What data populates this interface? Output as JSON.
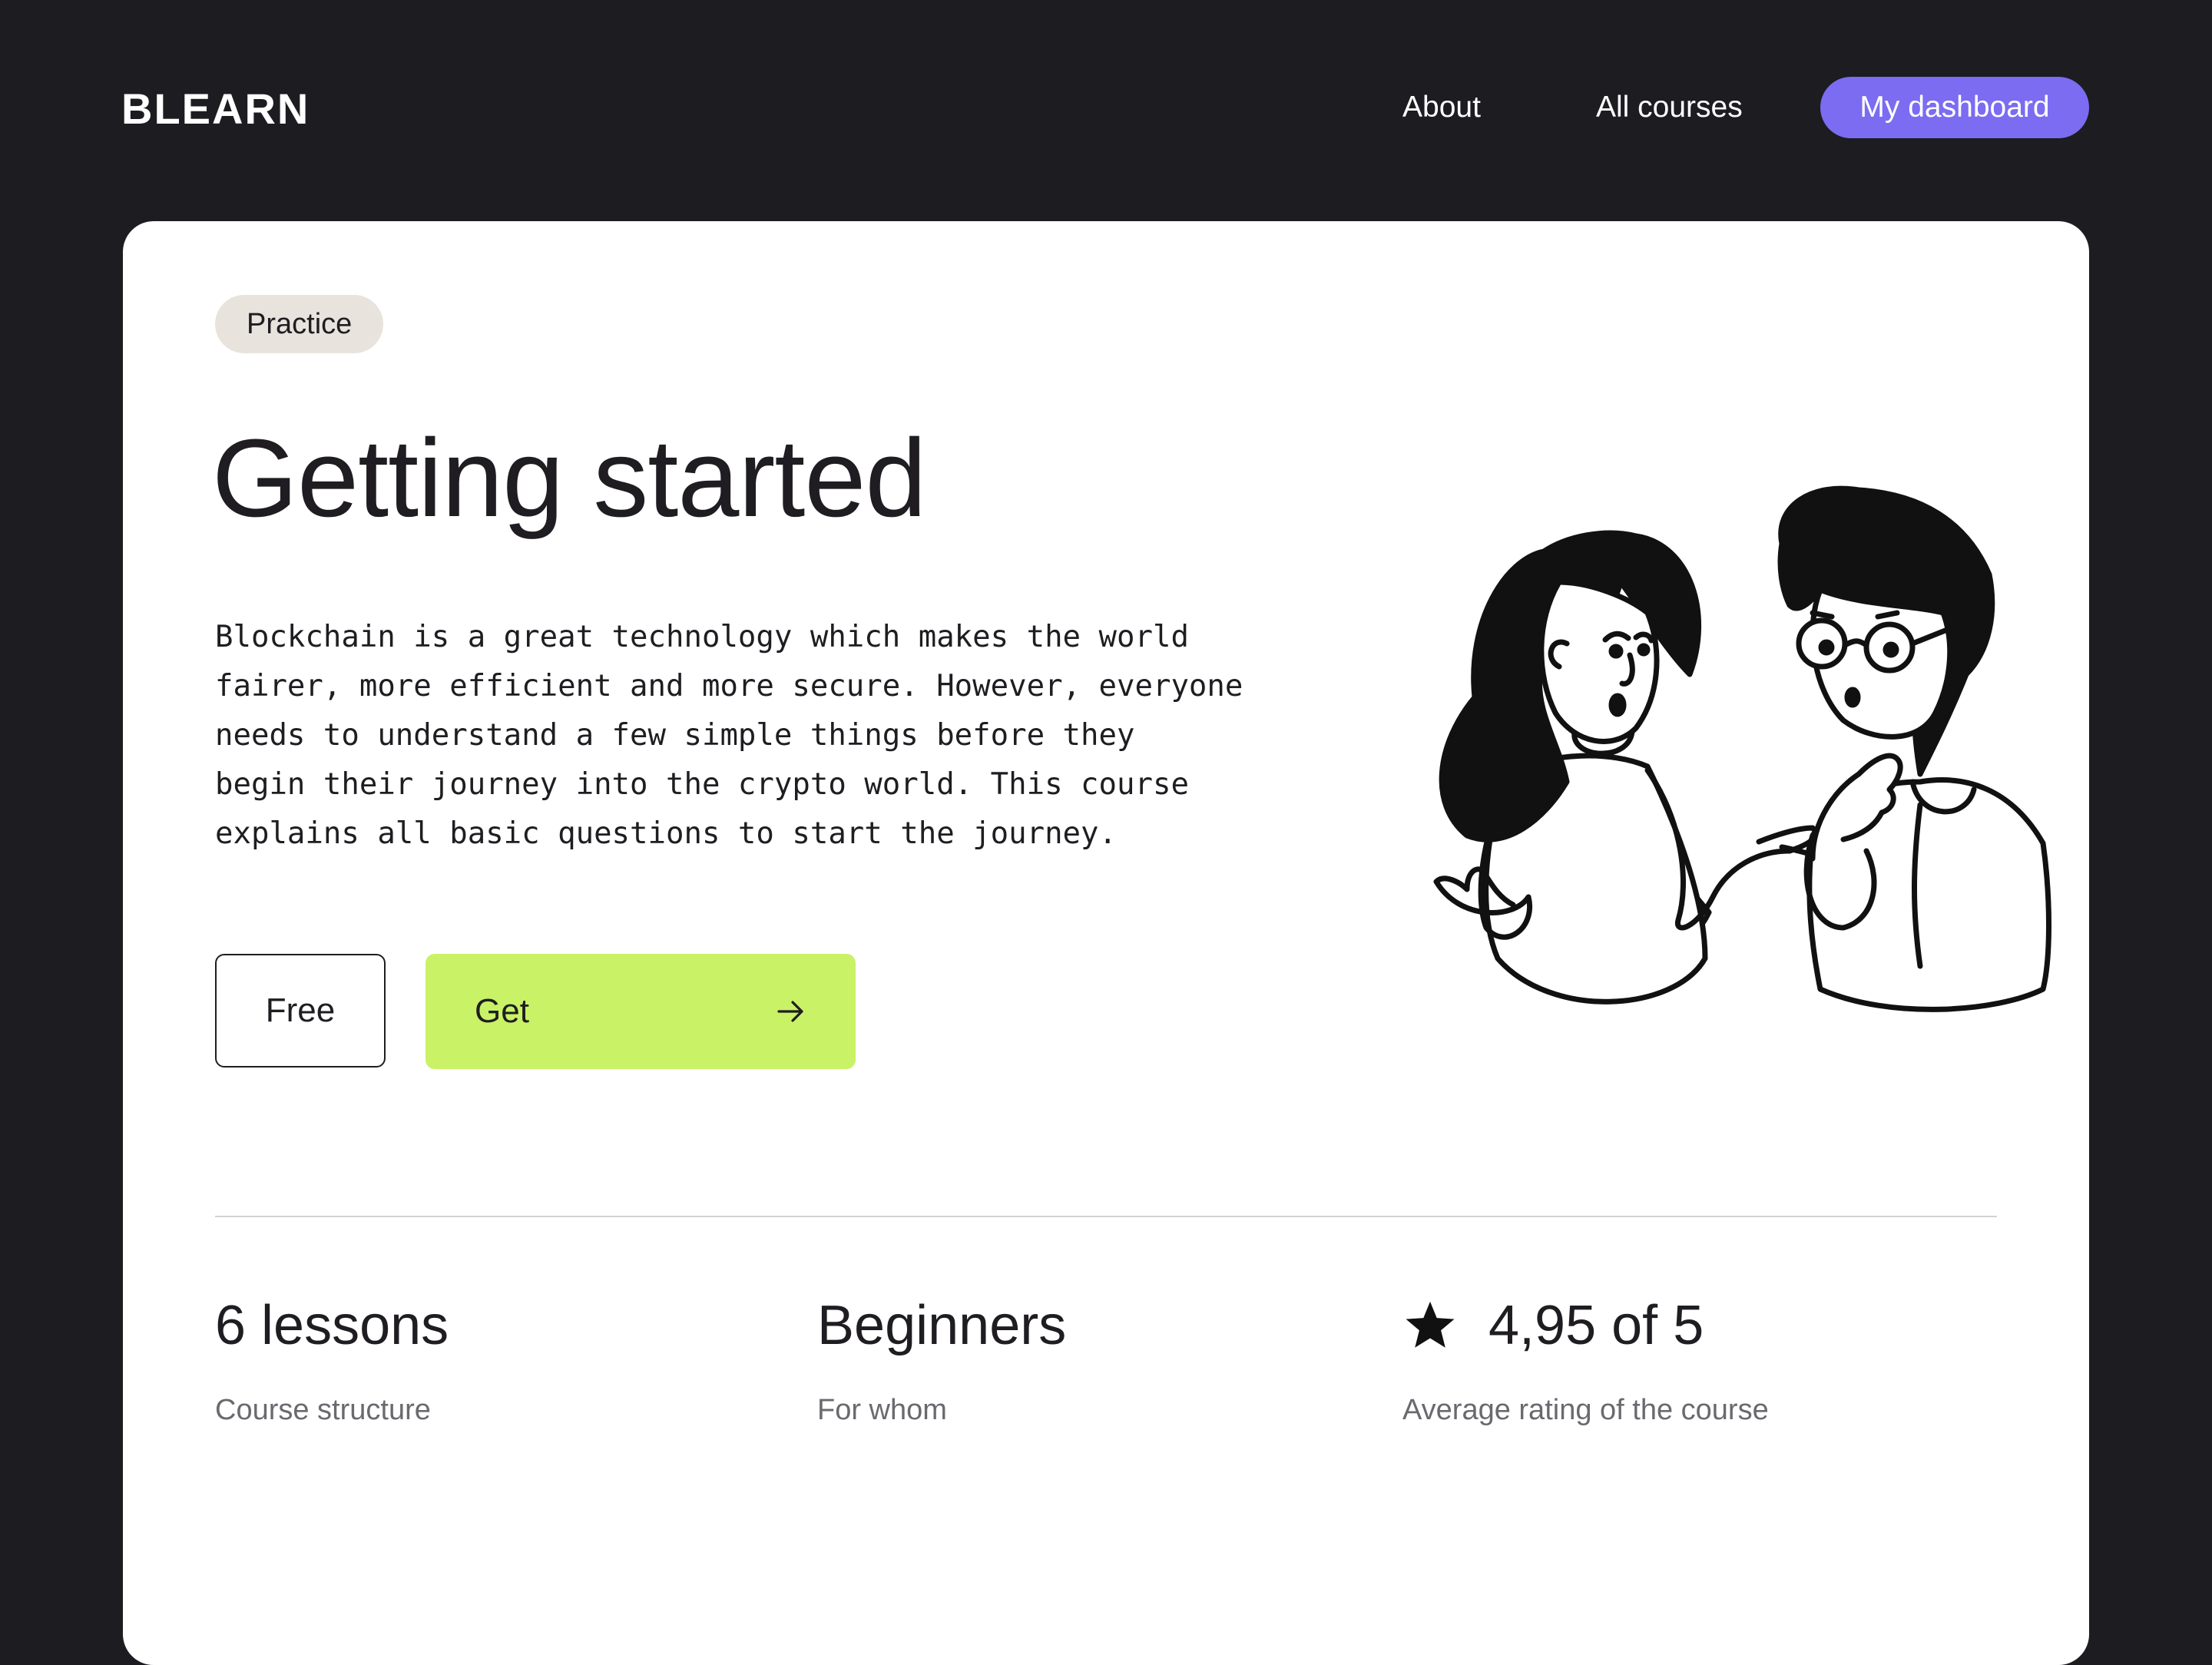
{
  "header": {
    "logo": "BLEARN",
    "nav": {
      "about": "About",
      "all_courses": "All courses",
      "dashboard": "My dashboard"
    }
  },
  "course": {
    "tag": "Practice",
    "title": "Getting started",
    "description": "Blockchain is a great technology which makes the world\nfairer, more efficient and more secure. However, everyone\nneeds to understand a few simple things before they\nbegin their journey into the crypto world. This course\nexplains all basic questions to start the journey.",
    "price_label": "Free",
    "get_label": "Get"
  },
  "stats": {
    "lessons": {
      "value": "6 lessons",
      "label": "Course structure"
    },
    "audience": {
      "value": "Beginners",
      "label": "For whom"
    },
    "rating": {
      "value": "4,95 of 5",
      "label": "Average rating of the course"
    }
  },
  "icons": {
    "get_button": "arrow-right-icon",
    "rating": "star-icon"
  },
  "colors": {
    "background": "#1d1c20",
    "accent_purple": "#7b6cf1",
    "accent_lime": "#c9f266",
    "tag_bg": "#e8e3dd",
    "text": "#1f1d21"
  }
}
